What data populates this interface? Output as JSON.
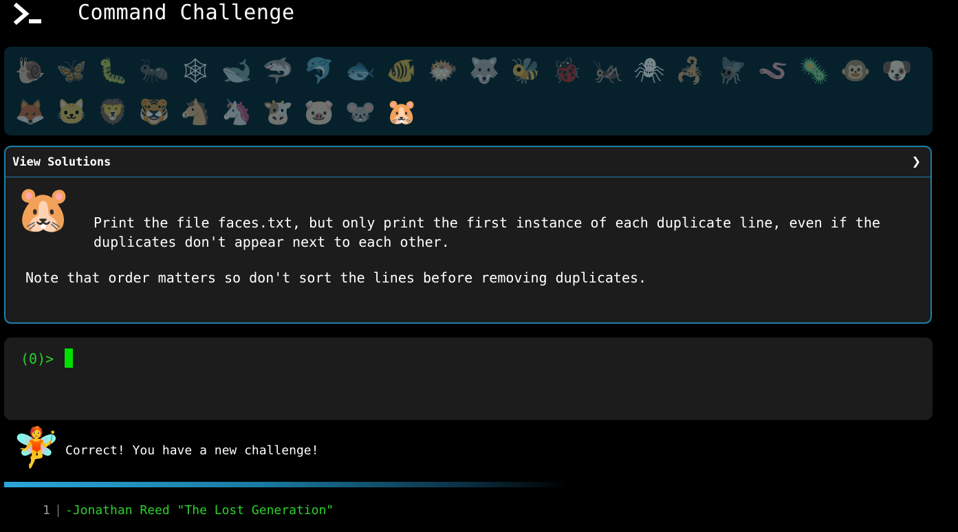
{
  "header": {
    "title": "Command Challenge",
    "logo_icon": "terminal-prompt-icon"
  },
  "animals": [
    {
      "name": "snail",
      "glyph": "🐌",
      "dim": true
    },
    {
      "name": "butterfly",
      "glyph": "🦋",
      "dim": true
    },
    {
      "name": "caterpillar",
      "glyph": "🐛",
      "dim": true
    },
    {
      "name": "ant",
      "glyph": "🐜",
      "dim": true
    },
    {
      "name": "spider-web",
      "glyph": "🕸",
      "dim": true
    },
    {
      "name": "whale",
      "glyph": "🐋",
      "dim": true
    },
    {
      "name": "shark",
      "glyph": "🦈",
      "dim": true
    },
    {
      "name": "dolphin",
      "glyph": "🐬",
      "dim": true
    },
    {
      "name": "fish",
      "glyph": "🐟",
      "dim": true
    },
    {
      "name": "tropical-fish",
      "glyph": "🐠",
      "dim": true
    },
    {
      "name": "blowfish",
      "glyph": "🐡",
      "dim": true
    },
    {
      "name": "wolf",
      "glyph": "🐺",
      "dim": true
    },
    {
      "name": "bee",
      "glyph": "🐝",
      "dim": true
    },
    {
      "name": "ladybug",
      "glyph": "🐞",
      "dim": true
    },
    {
      "name": "cricket",
      "glyph": "🦗",
      "dim": true
    },
    {
      "name": "spider",
      "glyph": "🕷",
      "dim": true
    },
    {
      "name": "scorpion",
      "glyph": "🦂",
      "dim": true
    },
    {
      "name": "fly",
      "glyph": "🪰",
      "dim": true
    },
    {
      "name": "worm",
      "glyph": "🪱",
      "dim": true
    },
    {
      "name": "microbe",
      "glyph": "🦠",
      "dim": true
    },
    {
      "name": "monkey",
      "glyph": "🐵",
      "dim": true
    },
    {
      "name": "dog",
      "glyph": "🐶",
      "dim": true
    },
    {
      "name": "fox",
      "glyph": "🦊",
      "dim": true
    },
    {
      "name": "cat",
      "glyph": "🐱",
      "dim": true
    },
    {
      "name": "lion",
      "glyph": "🦁",
      "dim": true
    },
    {
      "name": "tiger",
      "glyph": "🐯",
      "dim": true
    },
    {
      "name": "horse",
      "glyph": "🐴",
      "dim": true
    },
    {
      "name": "unicorn",
      "glyph": "🦄",
      "dim": true
    },
    {
      "name": "cow",
      "glyph": "🐮",
      "dim": true
    },
    {
      "name": "pig",
      "glyph": "🐷",
      "dim": true
    },
    {
      "name": "mouse",
      "glyph": "🐭",
      "dim": true
    },
    {
      "name": "hamster",
      "glyph": "🐹",
      "dim": false
    }
  ],
  "challenge": {
    "solutions_label": "View Solutions",
    "chevron": "❯",
    "avatar_glyph": "🐹",
    "description": "Print the file faces.txt, but only print the first instance of each duplicate line, even if the duplicates don't appear next to each other.",
    "note": "Note that order matters so don't sort the lines before removing duplicates."
  },
  "terminal": {
    "prompt": "(0)>"
  },
  "feedback": {
    "avatar_glyph": "🧚",
    "message": "Correct! You have a new challenge!",
    "progress": 0.6
  },
  "output": {
    "line_number": "1",
    "text": "-Jonathan Reed \"The Lost Generation\""
  },
  "colors": {
    "background": "#000000",
    "icon_bar": "#06212c",
    "panel": "#1c1c1c",
    "accent_border": "#1e7fa8",
    "terminal_green": "#2bd22b"
  }
}
